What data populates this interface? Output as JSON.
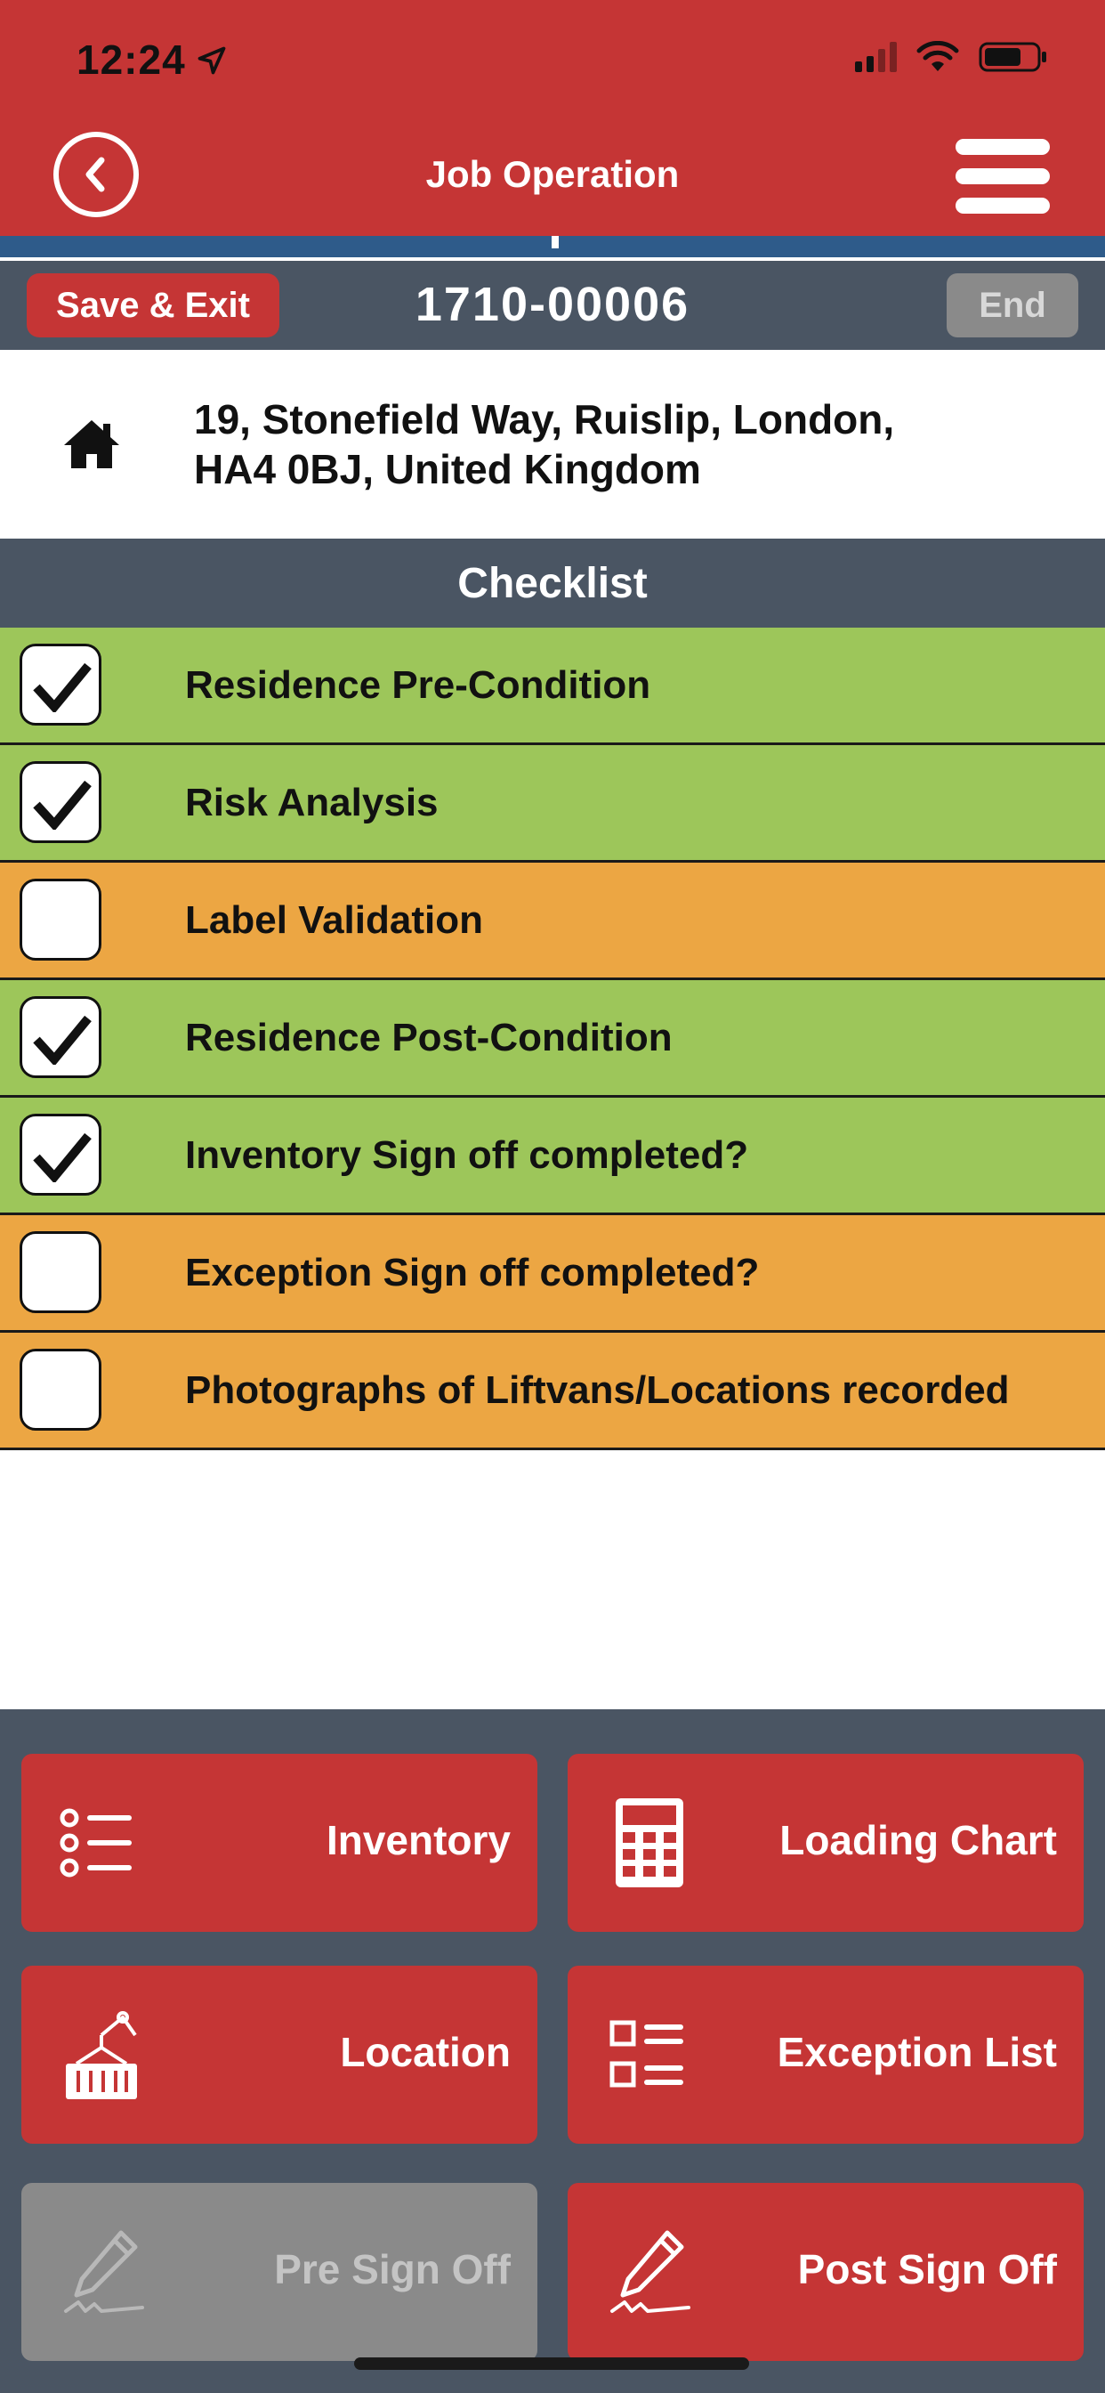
{
  "status_bar": {
    "time": "12:24"
  },
  "header": {
    "title": "Job Operation"
  },
  "job_bar": {
    "save_exit_label": "Save & Exit",
    "job_number": "1710-00006",
    "end_label": "End"
  },
  "address": {
    "line1": "19,  Stonefield Way, Ruislip, London,",
    "line2": "HA4 0BJ, United Kingdom"
  },
  "checklist": {
    "title": "Checklist",
    "items": [
      {
        "label": "Residence Pre-Condition",
        "checked": true
      },
      {
        "label": "Risk Analysis",
        "checked": true
      },
      {
        "label": "Label Validation",
        "checked": false
      },
      {
        "label": "Residence Post-Condition",
        "checked": true
      },
      {
        "label": "Inventory Sign off completed?",
        "checked": true
      },
      {
        "label": "Exception Sign off completed?",
        "checked": false
      },
      {
        "label": "Photographs of Liftvans/Locations recorded",
        "checked": false
      }
    ]
  },
  "actions": {
    "inventory": {
      "label": "Inventory",
      "icon": "list-icon",
      "enabled": true
    },
    "loading_chart": {
      "label": "Loading Chart",
      "icon": "calculator-icon",
      "enabled": true
    },
    "location": {
      "label": "Location",
      "icon": "container-crane-icon",
      "enabled": true
    },
    "exception_list": {
      "label": "Exception List",
      "icon": "checklist-icon",
      "enabled": true
    },
    "pre_sign_off": {
      "label": "Pre Sign Off",
      "icon": "pen-signature-icon",
      "enabled": false
    },
    "post_sign_off": {
      "label": "Post Sign Off",
      "icon": "pen-signature-icon",
      "enabled": true
    }
  },
  "colors": {
    "header_red": "#c53535",
    "slate": "#4a5563",
    "done_green": "#9dc65a",
    "todo_orange": "#eca643",
    "disabled_gray": "#8a8a8a"
  }
}
